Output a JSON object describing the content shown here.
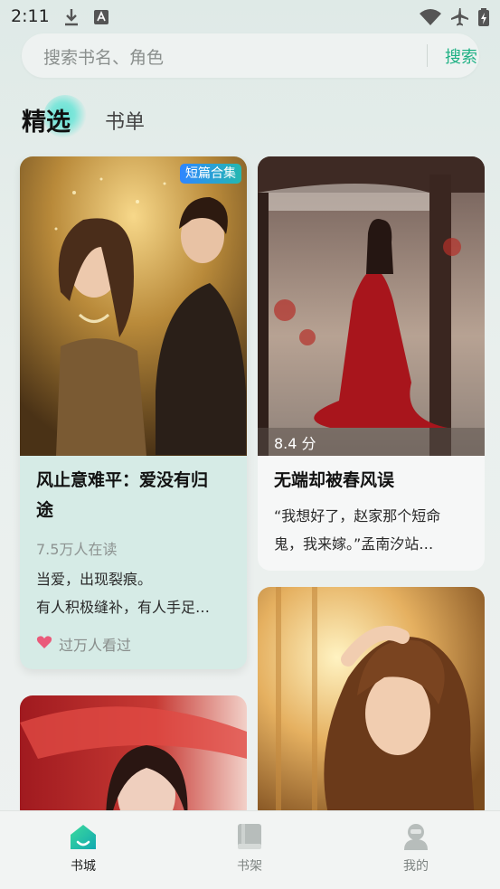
{
  "status_bar": {
    "time": "2:11"
  },
  "search": {
    "placeholder": "搜索书名、角色",
    "button": "搜索"
  },
  "tabs": {
    "active": "精选",
    "inactive": "书单"
  },
  "cards": [
    {
      "badge": "短篇合集",
      "title_line1": "风止意难平：爱没有归",
      "title_line2": "途",
      "readers": "7.5万人在读",
      "desc_line1": "当爱，出现裂痕。",
      "desc_line2": "有人积极缝补，有人手足…",
      "tag": "过万人看过"
    },
    {
      "rating": "8.4 分",
      "title": "无端却被春风误",
      "desc_line1": "“我想好了，赵家那个短命",
      "desc_line2": "鬼，我来嫁。”孟南汐站…"
    }
  ],
  "nav": [
    {
      "label": "书城",
      "icon": "home-icon",
      "active": true
    },
    {
      "label": "书架",
      "icon": "book-icon",
      "active": false
    },
    {
      "label": "我的",
      "icon": "profile-icon",
      "active": false
    }
  ],
  "colors": {
    "accent": "#1fb184",
    "badge": "#2f86ff",
    "nav_active": "#1fb184"
  }
}
